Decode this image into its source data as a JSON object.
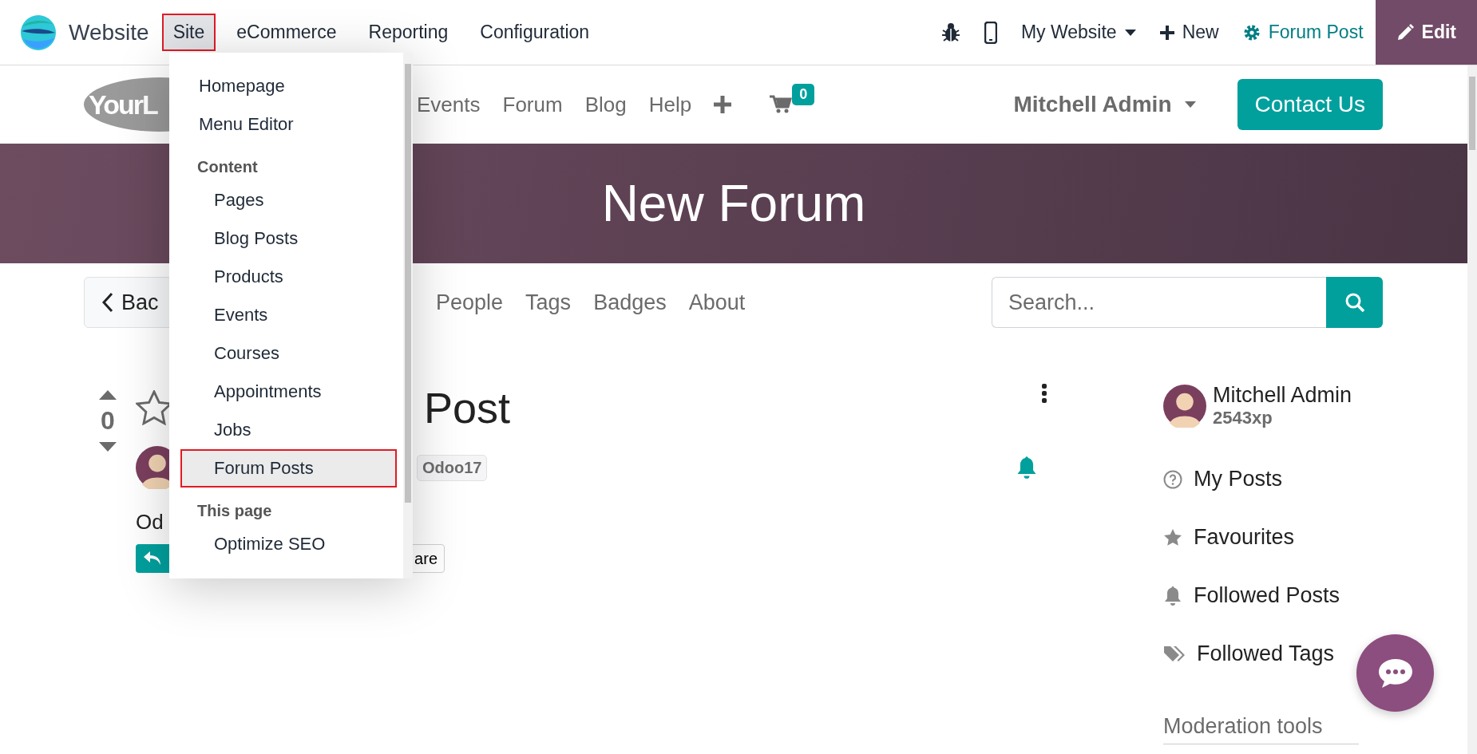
{
  "topbar": {
    "app_name": "Website",
    "menus": [
      {
        "label": "Site",
        "selected": true
      },
      {
        "label": "eCommerce",
        "selected": false
      },
      {
        "label": "Reporting",
        "selected": false
      },
      {
        "label": "Configuration",
        "selected": false
      }
    ],
    "website_switcher": "My Website",
    "new_button": "New",
    "page_settings": "Forum Post",
    "edit_button": "Edit"
  },
  "site_header": {
    "logo_text": "YourL",
    "nav": [
      "Events",
      "Forum",
      "Blog",
      "Help"
    ],
    "cart_count": "0",
    "user": "Mitchell Admin",
    "contact_button": "Contact Us"
  },
  "banner": {
    "title": "New Forum"
  },
  "forum_nav": {
    "back_button": "Bac",
    "links": [
      "People",
      "Tags",
      "Badges",
      "About"
    ],
    "search": {
      "placeholder": "Search..."
    }
  },
  "post": {
    "votes": "0",
    "favourite": false,
    "title": "Post",
    "tag": "Odoo17",
    "body": "Od",
    "share_button": "are",
    "following": true
  },
  "sidebar": {
    "user": {
      "name": "Mitchell Admin",
      "karma": "2543xp"
    },
    "links": [
      {
        "label": "My Posts",
        "kind": "question"
      },
      {
        "label": "Favourites",
        "kind": "star"
      },
      {
        "label": "Followed Posts",
        "kind": "bell"
      },
      {
        "label": "Followed Tags",
        "kind": "tags"
      }
    ],
    "section_title": "Moderation tools"
  },
  "site_menu": {
    "items": [
      {
        "kind": "item",
        "label": "Homepage",
        "selected": false
      },
      {
        "kind": "item",
        "label": "Menu Editor",
        "selected": false
      },
      {
        "kind": "group",
        "label": "Content",
        "children": [
          {
            "label": "Pages",
            "selected": false
          },
          {
            "label": "Blog Posts",
            "selected": false
          },
          {
            "label": "Products",
            "selected": false
          },
          {
            "label": "Events",
            "selected": false
          },
          {
            "label": "Courses",
            "selected": false
          },
          {
            "label": "Appointments",
            "selected": false
          },
          {
            "label": "Jobs",
            "selected": false
          },
          {
            "label": "Forum Posts",
            "selected": true
          }
        ]
      },
      {
        "kind": "group",
        "label": "This page",
        "children": [
          {
            "label": "Optimize SEO",
            "selected": false
          }
        ]
      }
    ]
  }
}
